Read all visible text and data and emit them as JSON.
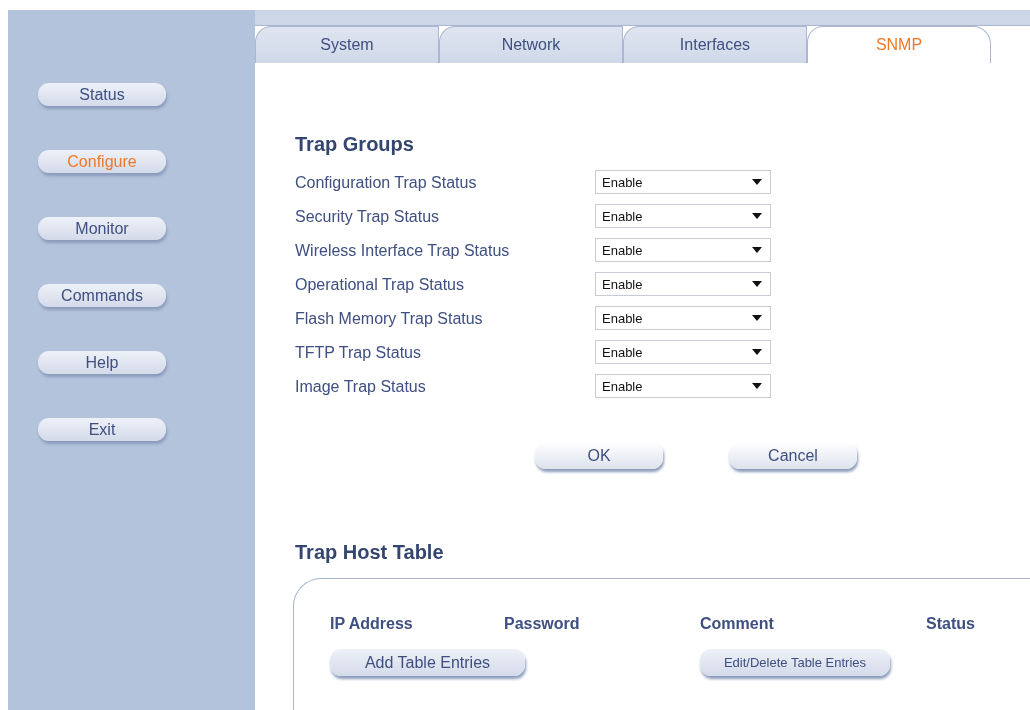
{
  "sidebar": {
    "items": [
      {
        "label": "Status",
        "selected": false
      },
      {
        "label": "Configure",
        "selected": true
      },
      {
        "label": "Monitor",
        "selected": false
      },
      {
        "label": "Commands",
        "selected": false
      },
      {
        "label": "Help",
        "selected": false
      },
      {
        "label": "Exit",
        "selected": false
      }
    ]
  },
  "tabs": [
    {
      "label": "System",
      "selected": false
    },
    {
      "label": "Network",
      "selected": false
    },
    {
      "label": "Interfaces",
      "selected": false
    },
    {
      "label": "SNMP",
      "selected": true
    }
  ],
  "trap_groups": {
    "title": "Trap Groups",
    "rows": [
      {
        "label": "Configuration Trap Status",
        "value": "Enable"
      },
      {
        "label": "Security Trap Status",
        "value": "Enable"
      },
      {
        "label": "Wireless Interface Trap Status",
        "value": "Enable"
      },
      {
        "label": "Operational Trap Status",
        "value": "Enable"
      },
      {
        "label": "Flash Memory Trap Status",
        "value": "Enable"
      },
      {
        "label": "TFTP Trap Status",
        "value": "Enable"
      },
      {
        "label": "Image Trap Status",
        "value": "Enable"
      }
    ],
    "buttons": [
      "OK",
      "Cancel"
    ]
  },
  "trap_host_table": {
    "title": "Trap Host Table",
    "columns": [
      "IP Address",
      "Password",
      "Comment",
      "Status"
    ],
    "buttons": [
      "Add Table Entries",
      "Edit/Delete Table Entries"
    ]
  }
}
